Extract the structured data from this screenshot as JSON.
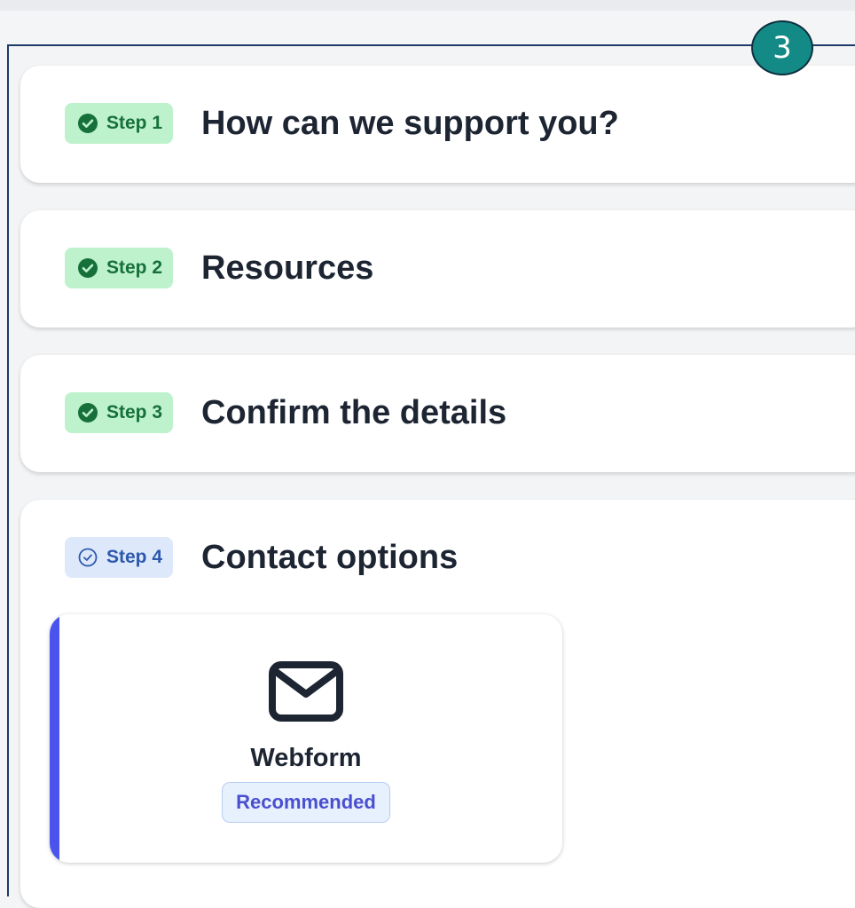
{
  "annotation_marker": "3",
  "steps": [
    {
      "badge": "Step 1",
      "title": "How can we support you?",
      "status": "complete",
      "icon": "check-circle-filled-icon"
    },
    {
      "badge": "Step 2",
      "title": "Resources",
      "status": "complete",
      "icon": "check-circle-filled-icon"
    },
    {
      "badge": "Step 3",
      "title": "Confirm the details",
      "status": "complete",
      "icon": "check-circle-filled-icon"
    },
    {
      "badge": "Step 4",
      "title": "Contact options",
      "status": "current",
      "icon": "check-circle-outline-icon"
    }
  ],
  "contact_option": {
    "label": "Webform",
    "tag": "Recommended",
    "icon": "mail-icon"
  },
  "colors": {
    "complete_badge_bg": "#bdf2cc",
    "complete_badge_text": "#17703a",
    "current_badge_bg": "#dde9fb",
    "current_badge_text": "#2d58ad",
    "accent": "#4b53ee",
    "marker": "#148a86"
  }
}
